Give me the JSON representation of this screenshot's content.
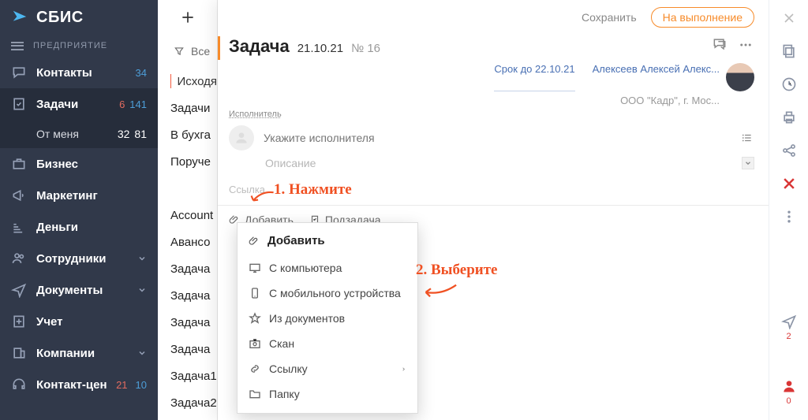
{
  "app": {
    "logo": "СБИС",
    "subtitle": "ПРЕДПРИЯТИЕ"
  },
  "nav": {
    "contacts": {
      "label": "Контакты",
      "count": "34"
    },
    "tasks": {
      "label": "Задачи",
      "c1": "6",
      "c2": "141"
    },
    "tasks_sub": {
      "label": "От меня",
      "c1": "32",
      "c2": "81"
    },
    "business": {
      "label": "Бизнес"
    },
    "marketing": {
      "label": "Маркетинг"
    },
    "money": {
      "label": "Деньги"
    },
    "staff": {
      "label": "Сотрудники"
    },
    "docs": {
      "label": "Документы"
    },
    "accounting": {
      "label": "Учет"
    },
    "companies": {
      "label": "Компании"
    },
    "contact_center": {
      "label": "Контакт-цен",
      "c1": "21",
      "c2": "10"
    }
  },
  "mid": {
    "filter": "Все",
    "items": [
      "Исходя",
      "Задачи",
      "В бухга",
      "Поруче",
      "Account",
      "Авансо",
      "Задача",
      "Задача",
      "Задача",
      "Задача",
      "Задача1",
      "Задача2"
    ]
  },
  "card": {
    "save": "Сохранить",
    "submit": "На выполнение",
    "title": "Задача",
    "date": "21.10.21",
    "num": "№ 16",
    "due": "Срок до 22.10.21",
    "person": "Алексеев Алексей Алекс...",
    "org": "ООО \"Кадр\", г. Мос...",
    "exec_label": "Исполнитель",
    "exec_ph": "Укажите исполнителя",
    "desc_ph": "Описание",
    "link_ph": "Ссылка",
    "attach": "Добавить",
    "subtask": "Подзадача"
  },
  "dropdown": {
    "title": "Добавить",
    "items": {
      "computer": "С компьютера",
      "mobile": "С мобильного устройства",
      "docs": "Из документов",
      "scan": "Скан",
      "link": "Ссылку",
      "folder": "Папку"
    }
  },
  "ann": {
    "one": "1. Нажмите",
    "two": "2. Выберите"
  },
  "rail": {
    "badge2": "2",
    "badge0": "0"
  }
}
